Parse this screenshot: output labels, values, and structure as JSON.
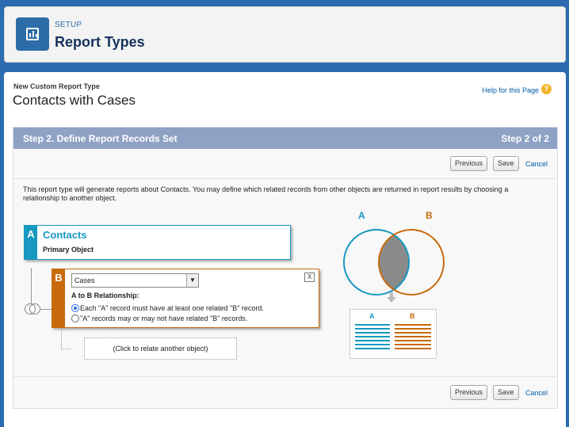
{
  "header": {
    "eyebrow": "SETUP",
    "title": "Report Types",
    "icon": "report-chart-icon"
  },
  "page": {
    "crumb": "New Custom Report Type",
    "title": "Contacts with Cases",
    "help_link": "Help for this Page",
    "help_icon": "?"
  },
  "step": {
    "title": "Step 2. Define Report Records Set",
    "count": "Step 2 of 2"
  },
  "buttons": {
    "previous": "Previous",
    "save": "Save",
    "cancel": "Cancel"
  },
  "description": "This report type will generate reports about Contacts. You may define which related records from other objects are returned in report results by choosing a relationship to another object.",
  "object_a": {
    "letter": "A",
    "name": "Contacts",
    "subtitle": "Primary Object"
  },
  "object_b": {
    "letter": "B",
    "selected": "Cases",
    "close": "X",
    "relationship_label": "A to B Relationship:",
    "options": [
      {
        "label": "Each \"A\" record must have at least one related \"B\" record.",
        "selected": true
      },
      {
        "label": "\"A\" records may or may not have related \"B\" records.",
        "selected": false
      }
    ]
  },
  "add_object": "(Click to relate another object)",
  "diagram": {
    "label_a": "A",
    "label_b": "B",
    "color_a": "#1798c1",
    "color_b": "#c96a0c",
    "overlap_color": "#8a8a8a",
    "arrow_icon": "down-arrow-icon"
  }
}
